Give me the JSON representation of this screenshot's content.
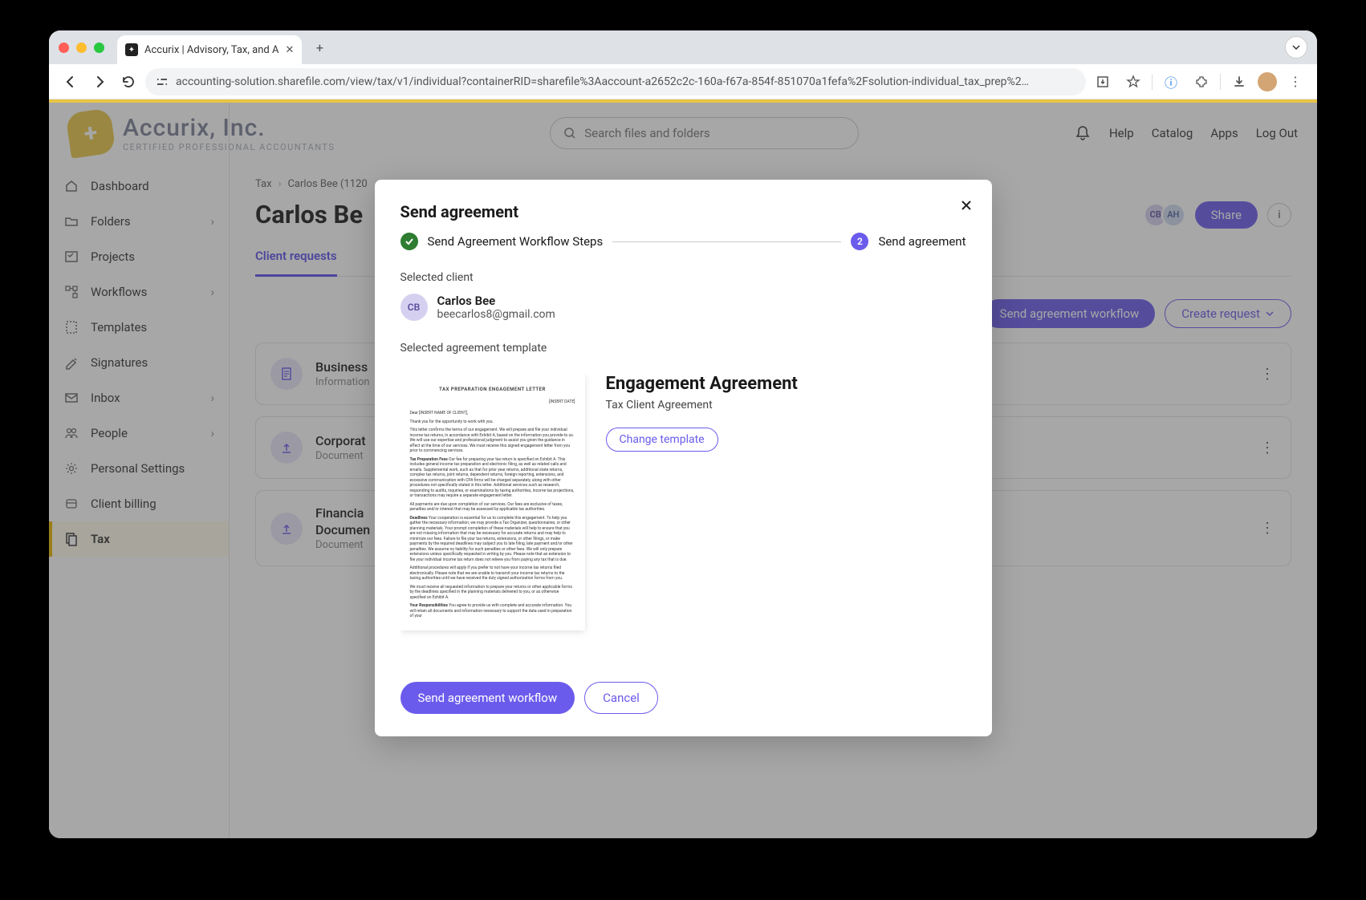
{
  "browser": {
    "tab_title": "Accurix | Advisory, Tax, and A",
    "url": "accounting-solution.sharefile.com/view/tax/v1/individual?containerRID=sharefile%3Aaccount-a2652c2c-160a-f67a-854f-851070a1fefa%2Fsolution-individual_tax_prep%2…"
  },
  "header": {
    "company": "Accurix, Inc.",
    "tagline": "CERTIFIED PROFESSIONAL ACCOUNTANTS",
    "search_placeholder": "Search files and folders",
    "links": {
      "help": "Help",
      "catalog": "Catalog",
      "apps": "Apps",
      "logout": "Log Out"
    }
  },
  "sidebar": {
    "items": [
      {
        "label": "Dashboard"
      },
      {
        "label": "Folders"
      },
      {
        "label": "Projects"
      },
      {
        "label": "Workflows"
      },
      {
        "label": "Templates"
      },
      {
        "label": "Signatures"
      },
      {
        "label": "Inbox"
      },
      {
        "label": "People"
      },
      {
        "label": "Personal Settings"
      },
      {
        "label": "Client billing"
      },
      {
        "label": "Tax"
      }
    ]
  },
  "breadcrumb": {
    "a": "Tax",
    "b": "Carlos Bee (1120"
  },
  "page": {
    "title": "Carlos Be",
    "tab_client_requests": "Client requests",
    "avatars": {
      "cb": "CB",
      "ah": "AH"
    },
    "share_btn": "Share",
    "send_workflow_btn": "Send agreement workflow",
    "create_request_btn": "Create request"
  },
  "cards": [
    {
      "title": "Business",
      "sub": "Information"
    },
    {
      "title": "Corporat",
      "sub": "Document"
    },
    {
      "title": "Financia",
      "title2": "Documen",
      "sub": "Document"
    }
  ],
  "modal": {
    "title": "Send agreement",
    "step1": "Send Agreement Workflow Steps",
    "step2_num": "2",
    "step2": "Send agreement",
    "selected_client_label": "Selected client",
    "client_initials": "CB",
    "client_name": "Carlos Bee",
    "client_email": "beecarlos8@gmail.com",
    "selected_template_label": "Selected agreement template",
    "template_title": "Engagement Agreement",
    "template_sub": "Tax Client Agreement",
    "change_template": "Change template",
    "primary_btn": "Send agreement workflow",
    "cancel_btn": "Cancel",
    "preview": {
      "title": "TAX PREPARATION ENGAGEMENT LETTER",
      "date": "[INSERT DATE]",
      "dear": "Dear [INSERT NAME OF CLIENT],",
      "thank": "Thank you for the opportunity to work with you.",
      "p1": "This letter confirms the terms of our engagement. We will prepare and file your individual income tax returns, in accordance with Exhibit A, based on the information you provide to us. We will use our expertise and professional judgment to assist you given the guidance in effect at the time of our services. We must receive this signed engagement letter from you prior to commencing services.",
      "p2h": "Tax Preparation Fees",
      "p2": "Our fee for preparing your tax return is specified on Exhibit A. This includes general income tax preparation and electronic filing, as well as related calls and emails. Supplemental work, such as that for prior year returns, additional state returns, complex tax returns, joint returns, dependent returns, foreign reporting, extensions, and excessive communication with CPA firms will be charged separately, along with other procedures not specifically stated in this letter. Additional services such as research, responding to audits, inquiries, or examinations by taxing authorities, income tax projections, or transactions may require a separate engagement letter.",
      "p3": "All payments are due upon completion of our services. Our fees are exclusive of taxes, penalties and/or interest that may be assessed by applicable tax authorities.",
      "p4h": "Deadlines",
      "p4": "Your cooperation is essential for us to complete this engagement. To help you gather the necessary information, we may provide a Tax Organizer, questionnaires, or other planning materials. Your prompt completion of these materials will help to ensure that you are not missing information that may be necessary for accurate returns and may help to minimize our fees. Failure to file your tax returns, extensions, or other filings, or make payments by the required deadlines may subject you to late filing, late payment and/or other penalties. We assume no liability for such penalties or other fees. We will only prepare extensions unless specifically requested in writing by you. Please note that an extension to file your individual income tax return does not relieve you from paying any tax that is due.",
      "p5": "Additional procedures will apply if you prefer to not have your income tax returns filed electronically. Please note that we are unable to transmit your income tax returns to the taxing authorities until we have received the duly signed authorization forms from you.",
      "p6": "We must receive all requested information to prepare your returns or other applicable forms by the deadlines specified in the planning materials delivered to you, or as otherwise specified on Exhibit A.",
      "p7h": "Your Responsibilities",
      "p7": "You agree to provide us with complete and accurate information. You will retain all documents and information necessary to support the data used in preparation of your"
    }
  }
}
